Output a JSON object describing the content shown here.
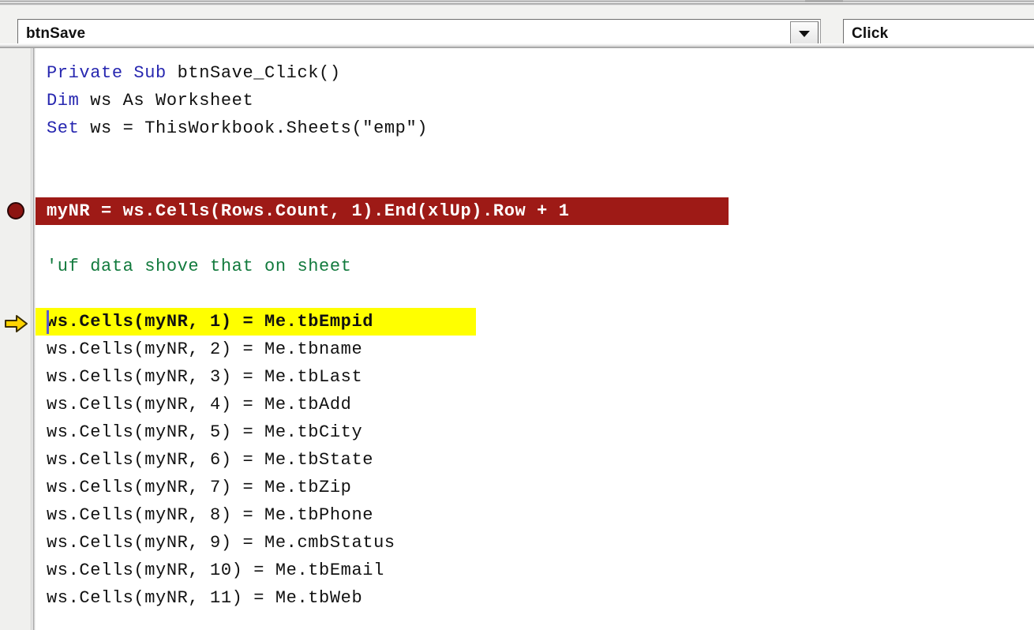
{
  "window": {
    "title": "Microsoft Visual Basic for Applications - Code Window",
    "app": "vba-editor"
  },
  "toolbar": {
    "object_combo": {
      "name": "object-combo",
      "value": "btnSave",
      "placeholder": "btnSave",
      "dropdown_icon": "chevron-down-icon"
    },
    "procedure_combo": {
      "name": "procedure-combo",
      "value": "Click",
      "placeholder": "Click",
      "dropdown_icon": "chevron-down-icon"
    }
  },
  "gutter": {
    "breakpoint_marker": "breakpoint-dot-icon",
    "current_statement_marker": "current-statement-arrow-icon",
    "breakpoint_line_index": 5,
    "current_line_index": 9
  },
  "colors": {
    "keyword": "#2727b0",
    "comment": "#127a3d",
    "breakpoint_bg": "#9e1a16",
    "breakpoint_fg": "#ffffff",
    "current_line_bg": "#ffff00",
    "current_line_fg": "#111111",
    "code_fg": "#111111",
    "gutter_bg": "#f0f0ee",
    "toolbar_bg": "#f2f2f0"
  },
  "code": {
    "language": "vba",
    "lines": [
      {
        "idx": 0,
        "text": "Private Sub btnSave_Click()",
        "style": "keyword-lead",
        "keyword": "Private Sub",
        "rest": " btnSave_Click()"
      },
      {
        "idx": 1,
        "text": "Dim ws As Worksheet",
        "style": "keyword-lead",
        "keyword": "Dim",
        "rest": " ws As Worksheet"
      },
      {
        "idx": 2,
        "text": "Set ws = ThisWorkbook.Sheets(\"emp\")",
        "style": "keyword-lead",
        "keyword": "Set",
        "rest": " ws = ThisWorkbook.Sheets(\"emp\")"
      },
      {
        "idx": 3,
        "text": "",
        "style": "blank"
      },
      {
        "idx": 4,
        "text": "",
        "style": "blank"
      },
      {
        "idx": 5,
        "text": "myNR = ws.Cells(Rows.Count, 1).End(xlUp).Row + 1",
        "style": "breakpoint"
      },
      {
        "idx": 6,
        "text": "",
        "style": "blank"
      },
      {
        "idx": 7,
        "text": "'uf data shove that on sheet",
        "style": "comment"
      },
      {
        "idx": 8,
        "text": "",
        "style": "blank"
      },
      {
        "idx": 9,
        "text": "ws.Cells(myNR, 1) = Me.tbEmpid",
        "style": "current"
      },
      {
        "idx": 10,
        "text": "ws.Cells(myNR, 2) = Me.tbname",
        "style": "plain"
      },
      {
        "idx": 11,
        "text": "ws.Cells(myNR, 3) = Me.tbLast",
        "style": "plain"
      },
      {
        "idx": 12,
        "text": "ws.Cells(myNR, 4) = Me.tbAdd",
        "style": "plain"
      },
      {
        "idx": 13,
        "text": "ws.Cells(myNR, 5) = Me.tbCity",
        "style": "plain"
      },
      {
        "idx": 14,
        "text": "ws.Cells(myNR, 6) = Me.tbState",
        "style": "plain"
      },
      {
        "idx": 15,
        "text": "ws.Cells(myNR, 7) = Me.tbZip",
        "style": "plain"
      },
      {
        "idx": 16,
        "text": "ws.Cells(myNR, 8) = Me.tbPhone",
        "style": "plain"
      },
      {
        "idx": 17,
        "text": "ws.Cells(myNR, 9) = Me.cmbStatus",
        "style": "plain"
      },
      {
        "idx": 18,
        "text": "ws.Cells(myNR, 10) = Me.tbEmail",
        "style": "plain"
      },
      {
        "idx": 19,
        "text": "ws.Cells(myNR, 11) = Me.tbWeb",
        "style": "plain"
      }
    ]
  }
}
